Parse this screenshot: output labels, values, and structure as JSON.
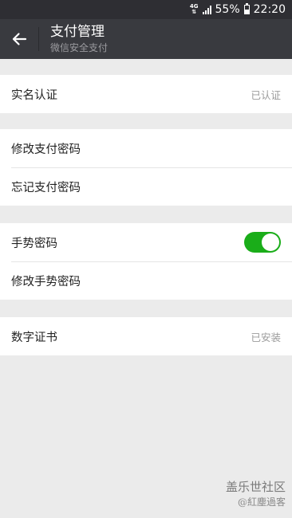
{
  "status_bar": {
    "network": "4G",
    "battery_text": "55%",
    "battery_level": 0.55,
    "time": "22:20"
  },
  "header": {
    "title": "支付管理",
    "subtitle": "微信安全支付"
  },
  "groups": [
    {
      "items": [
        {
          "label": "实名认证",
          "value": "已认证"
        }
      ]
    },
    {
      "items": [
        {
          "label": "修改支付密码"
        },
        {
          "label": "忘记支付密码"
        }
      ]
    },
    {
      "items": [
        {
          "label": "手势密码",
          "toggle": "on"
        },
        {
          "label": "修改手势密码"
        }
      ]
    },
    {
      "items": [
        {
          "label": "数字证书",
          "value": "已安装"
        }
      ]
    }
  ],
  "watermark": {
    "line1": "盖乐世社区",
    "line2": "@紅塵過客"
  },
  "colors": {
    "toggle_on": "#1aad19",
    "titlebar": "#393a3f",
    "background": "#ebebeb"
  }
}
